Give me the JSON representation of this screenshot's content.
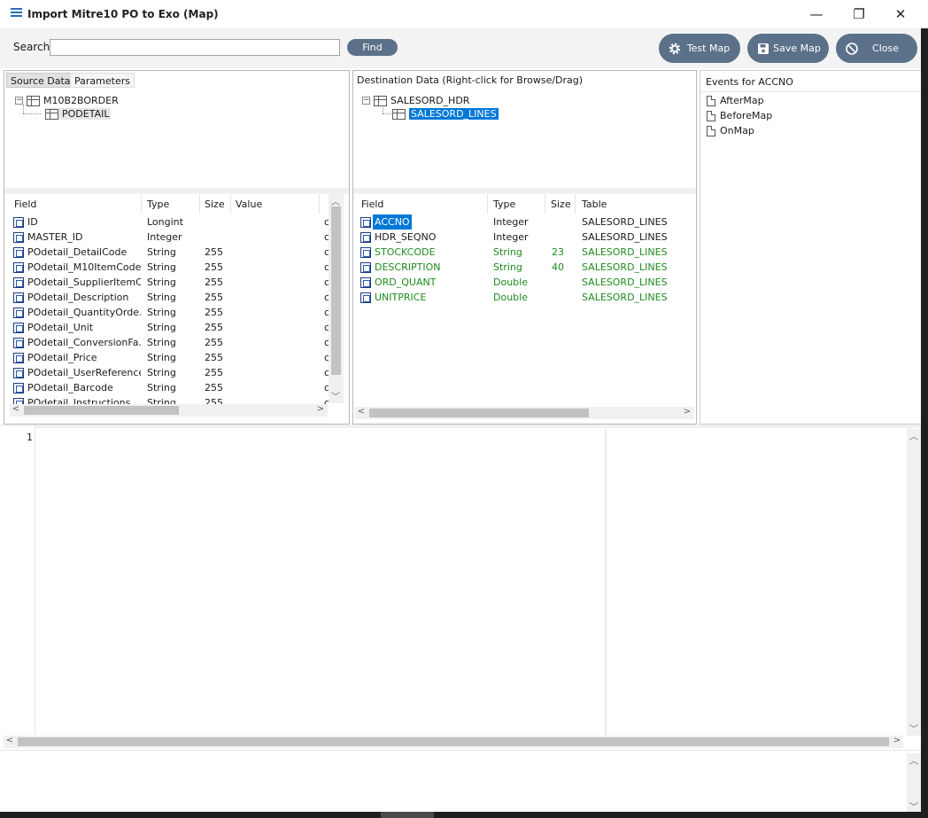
{
  "window": {
    "title": "Import Mitre10 PO to Exo (Map)",
    "controls": {
      "minimize": "—",
      "restore": "❐",
      "close": "✕"
    }
  },
  "toolbar": {
    "search_label": "Search",
    "search_value": "",
    "find_label": "Find",
    "test_map_label": "Test Map",
    "save_map_label": "Save Map",
    "close_label": "Close"
  },
  "source": {
    "tabs": [
      "Source Data",
      "Parameters"
    ],
    "tree": {
      "root": "M10B2BORDER",
      "child": "PODETAIL"
    },
    "columns": [
      "Field",
      "Type",
      "Size",
      "Value"
    ],
    "rows": [
      {
        "field": "ID",
        "type": "Longint",
        "size": "",
        "extra": "c"
      },
      {
        "field": "MASTER_ID",
        "type": "Integer",
        "size": "",
        "extra": "c"
      },
      {
        "field": "POdetail_DetailCode",
        "type": "String",
        "size": "255",
        "extra": "c"
      },
      {
        "field": "POdetail_M10ItemCode",
        "type": "String",
        "size": "255",
        "extra": "c"
      },
      {
        "field": "POdetail_SupplierItemC...",
        "type": "String",
        "size": "255",
        "extra": "c"
      },
      {
        "field": "POdetail_Description",
        "type": "String",
        "size": "255",
        "extra": "c"
      },
      {
        "field": "POdetail_QuantityOrde...",
        "type": "String",
        "size": "255",
        "extra": "c"
      },
      {
        "field": "POdetail_Unit",
        "type": "String",
        "size": "255",
        "extra": "c"
      },
      {
        "field": "POdetail_ConversionFa...",
        "type": "String",
        "size": "255",
        "extra": "c"
      },
      {
        "field": "POdetail_Price",
        "type": "String",
        "size": "255",
        "extra": "c"
      },
      {
        "field": "POdetail_UserReference",
        "type": "String",
        "size": "255",
        "extra": "c"
      },
      {
        "field": "POdetail_Barcode",
        "type": "String",
        "size": "255",
        "extra": "c"
      },
      {
        "field": "POdetail_Instructions",
        "type": "String",
        "size": "255",
        "extra": "c"
      }
    ]
  },
  "destination": {
    "header": "Destination Data  (Right-click for Browse/Drag)",
    "tree": {
      "root": "SALESORD_HDR",
      "child": "SALESORD_LINES"
    },
    "columns": [
      "Field",
      "Type",
      "Size",
      "Table"
    ],
    "rows": [
      {
        "field": "ACCNO",
        "type": "Integer",
        "size": "",
        "table": "SALESORD_LINES",
        "style": "selected"
      },
      {
        "field": "HDR_SEQNO",
        "type": "Integer",
        "size": "",
        "table": "SALESORD_LINES",
        "style": "normal"
      },
      {
        "field": "STOCKCODE",
        "type": "String",
        "size": "23",
        "table": "SALESORD_LINES",
        "style": "mapped"
      },
      {
        "field": "DESCRIPTION",
        "type": "String",
        "size": "40",
        "table": "SALESORD_LINES",
        "style": "mapped"
      },
      {
        "field": "ORD_QUANT",
        "type": "Double",
        "size": "",
        "table": "SALESORD_LINES",
        "style": "mapped"
      },
      {
        "field": "UNITPRICE",
        "type": "Double",
        "size": "",
        "table": "SALESORD_LINES",
        "style": "mapped"
      }
    ]
  },
  "events": {
    "header": "Events for ACCNO",
    "items": [
      "AfterMap",
      "BeforeMap",
      "OnMap"
    ]
  },
  "editor": {
    "line_number": "1",
    "content": ""
  },
  "colors": {
    "button": "#5b7189",
    "selected": "#0078d7",
    "mapped": "#1e8a1e"
  },
  "icons": [
    "menu-icon",
    "gear-icon",
    "save-icon",
    "cancel-icon",
    "table-icon",
    "field-icon",
    "document-icon"
  ]
}
